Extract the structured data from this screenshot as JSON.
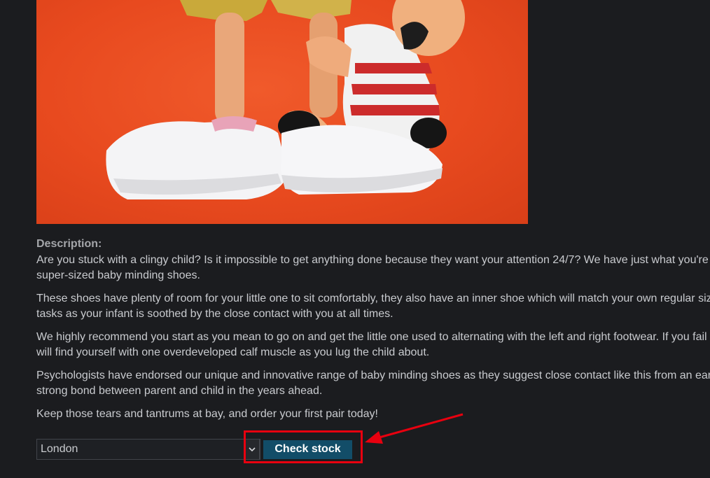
{
  "product": {
    "image_alt": "",
    "description": {
      "title": "Description:",
      "paragraphs": [
        "Are you stuck with a clingy child? Is it impossible to get anything done because they want your attention 24/7? We have just what you're",
        "super-sized baby minding shoes.",
        "These shoes have plenty of room for your little one to sit comfortably, they also have an inner shoe which will match your own regular siz",
        "tasks as your infant is soothed by the close contact with you at all times.",
        "We highly recommend you start as you mean to go on and get the little one used to alternating with the left and right footwear. If you fail",
        "will find yourself with one overdeveloped calf muscle as you lug the child about.",
        "Psychologists have endorsed our unique and innovative range of baby minding shoes as they suggest close contact like this from an ear",
        "strong bond between parent and child in the years ahead.",
        "Keep those tears and tantrums at bay, and order your first pair today!"
      ]
    }
  },
  "stock_check": {
    "selected_store": "London",
    "button_label": "Check stock"
  },
  "colors": {
    "background": "#1b1c1f",
    "button": "#124d68",
    "annotation": "#e8000f"
  },
  "icons": {
    "select_arrow": "chevron-down-icon",
    "annotation_arrow": "arrow-icon"
  }
}
